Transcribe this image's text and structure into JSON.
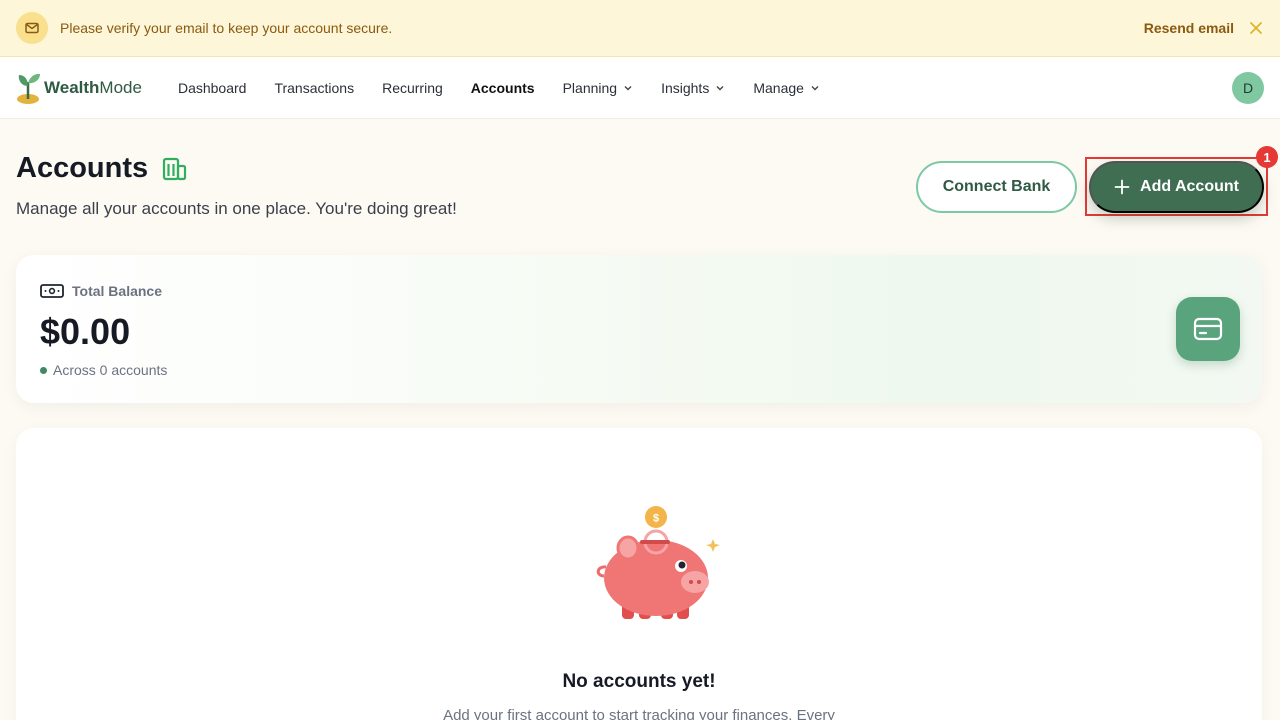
{
  "banner": {
    "message": "Please verify your email to keep your account secure.",
    "resend_label": "Resend email"
  },
  "nav": {
    "logo_bold": "Wealth",
    "logo_rest": "Mode",
    "links": [
      {
        "label": "Dashboard"
      },
      {
        "label": "Transactions"
      },
      {
        "label": "Recurring"
      },
      {
        "label": "Accounts"
      },
      {
        "label": "Planning"
      },
      {
        "label": "Insights"
      },
      {
        "label": "Manage"
      }
    ],
    "active": "Accounts",
    "avatar_initial": "D"
  },
  "header": {
    "title": "Accounts",
    "subtitle": "Manage all your accounts in one place. You're doing great!",
    "connect_label": "Connect Bank",
    "add_label": "Add Account",
    "badge": "1"
  },
  "balance": {
    "label": "Total Balance",
    "amount": "$0.00",
    "sub": "Across 0 accounts"
  },
  "empty": {
    "title": "No accounts yet!",
    "description": "Add your first account to start tracking your finances. Every"
  },
  "colors": {
    "brand": "#3f6e52",
    "accent": "#7cc9a5",
    "banner_bg": "#fdf6d8",
    "highlight": "#e53935"
  }
}
